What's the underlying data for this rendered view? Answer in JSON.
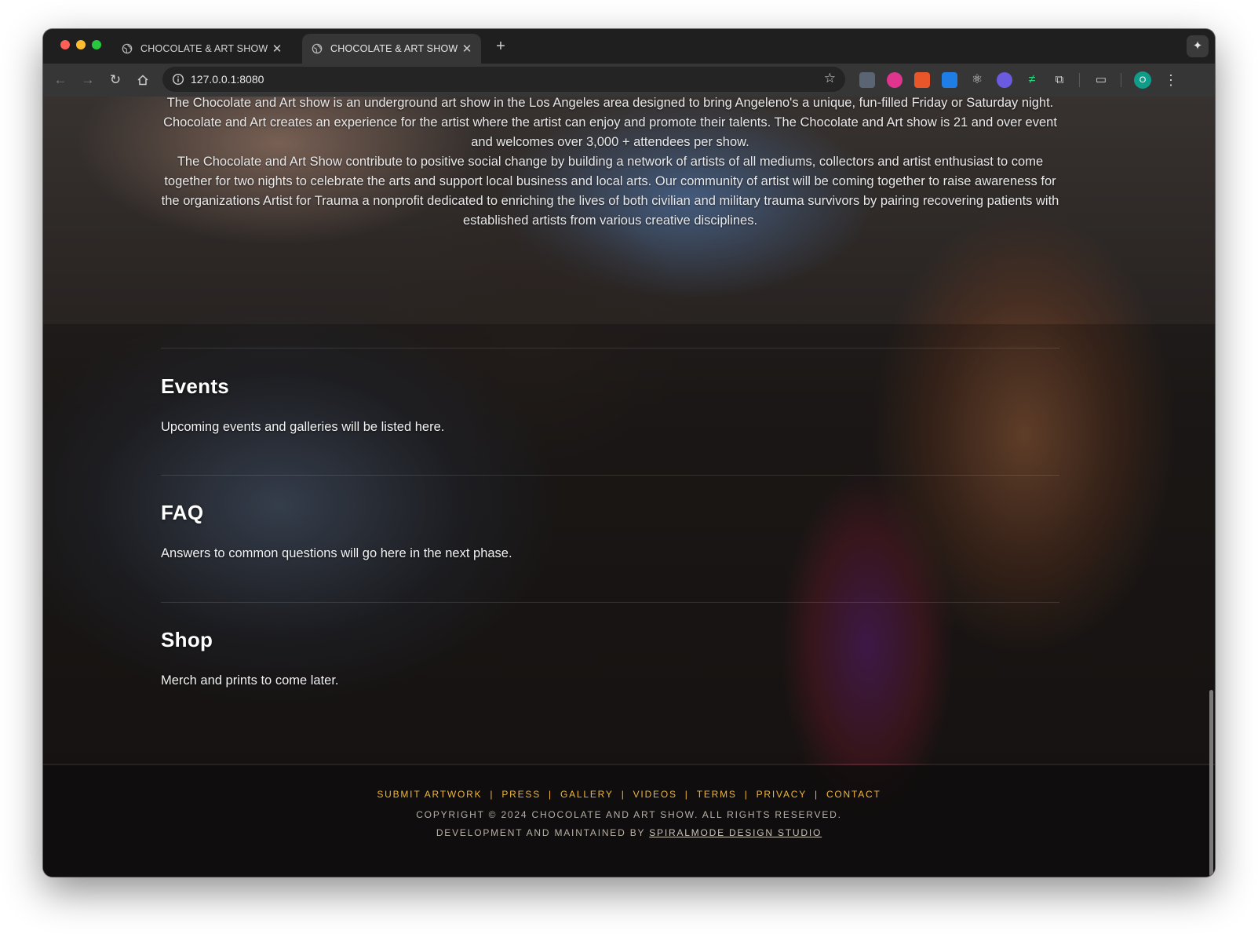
{
  "browser": {
    "tabs": [
      {
        "title": "CHOCOLATE & ART SHOW",
        "active": false
      },
      {
        "title": "CHOCOLATE & ART SHOW",
        "active": true
      }
    ],
    "url": "127.0.0.1:8080",
    "profile_initial": "O",
    "icons": [
      "back-arrow-icon",
      "forward-arrow-icon",
      "reload-icon",
      "home-icon",
      "site-info-icon",
      "bookmark-star-icon",
      "extensions-puzzle-icon",
      "tab-search-icon",
      "kebab-menu-icon",
      "sparkle-icon"
    ]
  },
  "about": {
    "p1": "The Chocolate and Art show is an underground art show in the Los Angeles area designed to bring Angeleno's a unique, fun-filled Friday or Saturday night. Chocolate and Art creates an experience for the artist where the artist can enjoy and promote their talents. The Chocolate and Art show is 21 and over event and welcomes over 3,000 + attendees per show.",
    "p2": "The Chocolate and Art Show contribute to positive social change by building a network of artists of all mediums, collectors and artist enthusiast to come together for two nights to celebrate the arts and support local business and local arts. Our community of artist will be coming together to raise awareness for the organizations Artist for Trauma a nonprofit dedicated to enriching the lives of both civilian and military trauma survivors by pairing recovering patients with established artists from various creative disciplines."
  },
  "sections": {
    "events": {
      "title": "Events",
      "text": "Upcoming events and galleries will be listed here."
    },
    "faq": {
      "title": "FAQ",
      "text": "Answers to common questions will go here in the next phase."
    },
    "shop": {
      "title": "Shop",
      "text": "Merch and prints to come later."
    }
  },
  "footer": {
    "links": [
      "SUBMIT ARTWORK",
      "PRESS",
      "GALLERY",
      "VIDEOS",
      "TERMS",
      "PRIVACY",
      "CONTACT"
    ],
    "separator": "|",
    "copyright": "COPYRIGHT © 2024 CHOCOLATE AND ART SHOW. ALL RIGHTS RESERVED.",
    "dev_prefix": "DEVELOPMENT AND MAINTAINED BY",
    "dev_studio": "SPIRALMODE DESIGN STUDIO"
  },
  "colors": {
    "accent": "#f0b63a",
    "footer_text": "#b8b0a6"
  }
}
